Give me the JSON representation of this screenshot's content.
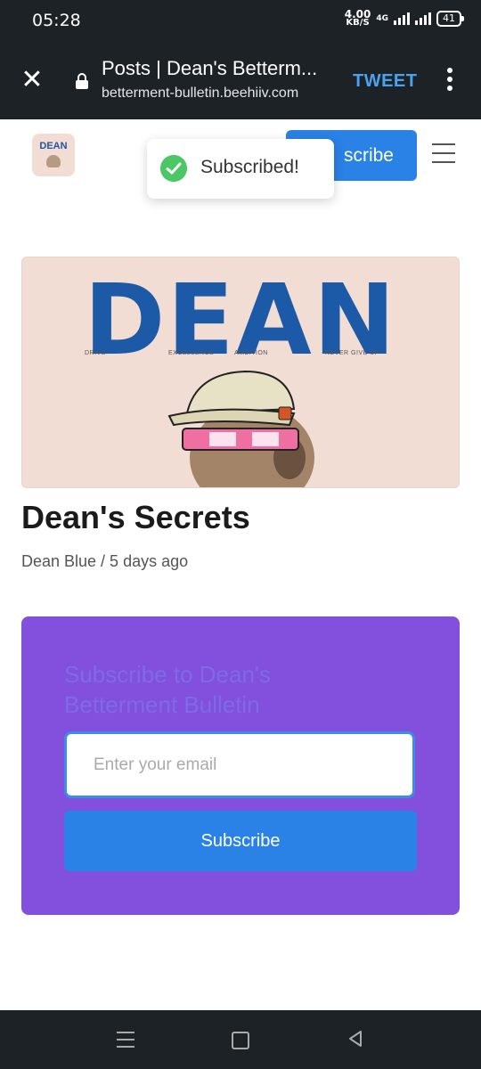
{
  "status_bar": {
    "time": "05:28",
    "speed_value": "4.00",
    "speed_unit": "KB/S",
    "network": "4G",
    "battery": "41"
  },
  "browser": {
    "page_title": "Posts | Dean's Betterm...",
    "domain": "betterment-bulletin.beehiiv.com",
    "tweet_label": "TWEET",
    "icons": {
      "close": "close-icon",
      "lock": "lock-icon",
      "menu": "more-vert-icon"
    }
  },
  "site": {
    "logo_text": "DEAN",
    "subscribe_label": "Subscribe",
    "subscribe_visible": "scribe"
  },
  "toast": {
    "message": "Subscribed!"
  },
  "hero": {
    "title": "DEAN",
    "words": [
      "DRIVE",
      "EXCELLENCE",
      "AMBITION",
      "NEVER GIVE UP"
    ]
  },
  "post": {
    "title": "Dean's Secrets",
    "meta": "Dean Blue / 5 days ago"
  },
  "subscribe_card": {
    "heading": "Subscribe to Dean's Betterment Bulletin",
    "email_placeholder": "Enter your email",
    "email_value": "",
    "button_label": "Subscribe",
    "background_color": "#8250dd"
  },
  "colors": {
    "accent": "#2a82e6",
    "brand_blue": "#1c5aa8",
    "success": "#4cc765",
    "system_bar": "#1d2227"
  },
  "nav_bar": {
    "icons": [
      "menu-icon",
      "home-icon",
      "back-icon"
    ]
  }
}
